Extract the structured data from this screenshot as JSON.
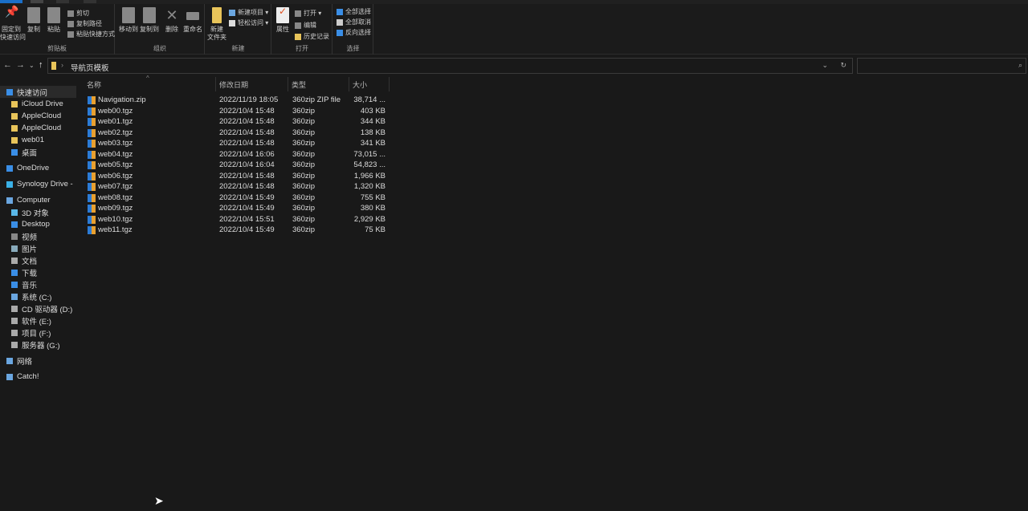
{
  "ribbon": {
    "clipboard": {
      "label": "剪贴板",
      "pin": "固定到\n快速访问",
      "copy": "复制",
      "paste": "粘贴",
      "cut": "剪切",
      "copy_path": "复制路径",
      "paste_shortcut": "粘贴快捷方式"
    },
    "organize": {
      "label": "组织",
      "move_to": "移动到",
      "copy_to": "复制到",
      "delete": "删除",
      "rename": "重命名"
    },
    "new": {
      "label": "新建",
      "new_folder": "新建\n文件夹",
      "new_item": "新建项目 ▾",
      "easy_access": "轻松访问 ▾"
    },
    "open": {
      "label": "打开",
      "properties": "属性",
      "open": "打开 ▾",
      "edit": "编辑",
      "history": "历史记录"
    },
    "select": {
      "label": "选择",
      "select_all": "全部选择",
      "select_none": "全部取消",
      "invert": "反向选择"
    }
  },
  "address": {
    "path": "导航页模板",
    "search_placeholder": ""
  },
  "sidebar": {
    "items": [
      {
        "label": "快速访问",
        "icon": "star-icon",
        "color": "#3a8ee6"
      },
      {
        "label": "iCloud Drive",
        "icon": "folder-icon",
        "color": "#e8c45a"
      },
      {
        "label": "AppleCloud",
        "icon": "folder-icon",
        "color": "#e8c45a"
      },
      {
        "label": "AppleCloud",
        "icon": "folder-icon",
        "color": "#e8c45a"
      },
      {
        "label": "web01",
        "icon": "folder-icon",
        "color": "#e8c45a"
      },
      {
        "label": "桌面",
        "icon": "desktop-icon",
        "color": "#3a8ee6"
      },
      {
        "label": "OneDrive",
        "icon": "cloud-icon",
        "color": "#3a8ee6"
      },
      {
        "label": "Synology Drive -",
        "icon": "synology-icon",
        "color": "#3ab0e6"
      },
      {
        "label": "Computer",
        "icon": "computer-icon",
        "color": "#6aa6e0"
      },
      {
        "label": "3D 对象",
        "icon": "cube-icon",
        "color": "#5ab8e8"
      },
      {
        "label": "Desktop",
        "icon": "desktop-icon",
        "color": "#3a8ee6"
      },
      {
        "label": "视频",
        "icon": "video-icon",
        "color": "#888"
      },
      {
        "label": "图片",
        "icon": "picture-icon",
        "color": "#8ab"
      },
      {
        "label": "文档",
        "icon": "document-icon",
        "color": "#aaa"
      },
      {
        "label": "下载",
        "icon": "download-icon",
        "color": "#3a8ee6"
      },
      {
        "label": "音乐",
        "icon": "music-icon",
        "color": "#3a8ee6"
      },
      {
        "label": "系统 (C:)",
        "icon": "drive-icon",
        "color": "#6aa6e0"
      },
      {
        "label": "CD 驱动器 (D:)",
        "icon": "cd-drive-icon",
        "color": "#aaa"
      },
      {
        "label": "软件 (E:)",
        "icon": "drive-icon",
        "color": "#aaa"
      },
      {
        "label": "项目 (F:)",
        "icon": "drive-icon",
        "color": "#aaa"
      },
      {
        "label": "服务器 (G:)",
        "icon": "drive-icon",
        "color": "#aaa"
      },
      {
        "label": "网络",
        "icon": "network-icon",
        "color": "#6aa6e0"
      },
      {
        "label": "Catch!",
        "icon": "catch-icon",
        "color": "#6aa6e0"
      }
    ]
  },
  "columns": {
    "name": "名称",
    "date": "修改日期",
    "type": "类型",
    "size": "大小"
  },
  "files": [
    {
      "name": "Navigation.zip",
      "date": "2022/11/19 18:05",
      "type": "360zip ZIP file",
      "size": "38,714 ..."
    },
    {
      "name": "web00.tgz",
      "date": "2022/10/4 15:48",
      "type": "360zip",
      "size": "403 KB"
    },
    {
      "name": "web01.tgz",
      "date": "2022/10/4 15:48",
      "type": "360zip",
      "size": "344 KB"
    },
    {
      "name": "web02.tgz",
      "date": "2022/10/4 15:48",
      "type": "360zip",
      "size": "138 KB"
    },
    {
      "name": "web03.tgz",
      "date": "2022/10/4 15:48",
      "type": "360zip",
      "size": "341 KB"
    },
    {
      "name": "web04.tgz",
      "date": "2022/10/4 16:06",
      "type": "360zip",
      "size": "73,015 ..."
    },
    {
      "name": "web05.tgz",
      "date": "2022/10/4 16:04",
      "type": "360zip",
      "size": "54,823 ..."
    },
    {
      "name": "web06.tgz",
      "date": "2022/10/4 15:48",
      "type": "360zip",
      "size": "1,966 KB"
    },
    {
      "name": "web07.tgz",
      "date": "2022/10/4 15:48",
      "type": "360zip",
      "size": "1,320 KB"
    },
    {
      "name": "web08.tgz",
      "date": "2022/10/4 15:49",
      "type": "360zip",
      "size": "755 KB"
    },
    {
      "name": "web09.tgz",
      "date": "2022/10/4 15:49",
      "type": "360zip",
      "size": "380 KB"
    },
    {
      "name": "web10.tgz",
      "date": "2022/10/4 15:51",
      "type": "360zip",
      "size": "2,929 KB"
    },
    {
      "name": "web11.tgz",
      "date": "2022/10/4 15:49",
      "type": "360zip",
      "size": "75 KB"
    }
  ]
}
